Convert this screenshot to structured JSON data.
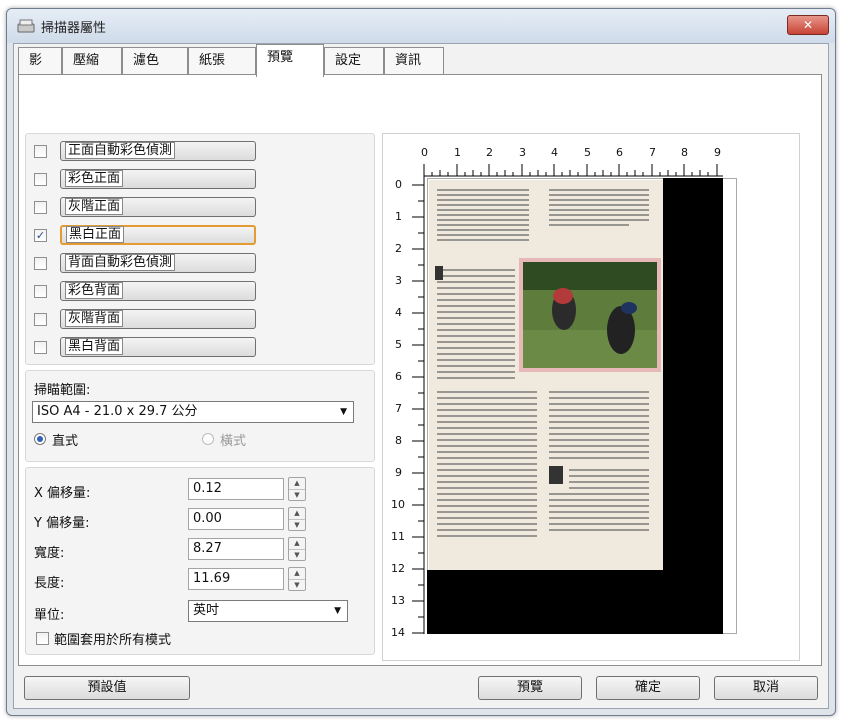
{
  "window": {
    "title": "掃描器屬性",
    "close_label": "✕"
  },
  "tabs": [
    "影像",
    "壓縮",
    "濾色",
    "紙張",
    "預覽",
    "設定",
    "資訊"
  ],
  "active_tab": 4,
  "preview_options": [
    {
      "label": "正面自動彩色偵測",
      "checked": false
    },
    {
      "label": "彩色正面",
      "checked": false
    },
    {
      "label": "灰階正面",
      "checked": false
    },
    {
      "label": "黑白正面",
      "checked": true
    },
    {
      "label": "背面自動彩色偵測",
      "checked": false
    },
    {
      "label": "彩色背面",
      "checked": false
    },
    {
      "label": "灰階背面",
      "checked": false
    },
    {
      "label": "黑白背面",
      "checked": false
    }
  ],
  "scan_area": {
    "label": "掃瞄範圍:",
    "value": "ISO A4 - 21.0 x 29.7 公分",
    "portrait_label": "直式",
    "landscape_label": "橫式",
    "orientation": "portrait"
  },
  "fields": [
    {
      "label": "X 偏移量:",
      "value": "0.12"
    },
    {
      "label": "Y 偏移量:",
      "value": "0.00"
    },
    {
      "label": "寬度:",
      "value": "8.27"
    },
    {
      "label": "長度:",
      "value": "11.69"
    }
  ],
  "unit": {
    "label": "單位:",
    "value": "英吋"
  },
  "apply_all": {
    "label": "範圍套用於所有模式",
    "checked": false
  },
  "ruler": {
    "top": [
      "0",
      "1",
      "2",
      "3",
      "4",
      "5",
      "6",
      "7",
      "8",
      "9"
    ],
    "left": [
      "0",
      "1",
      "2",
      "3",
      "4",
      "5",
      "6",
      "7",
      "8",
      "9",
      "10",
      "11",
      "12",
      "13",
      "14"
    ]
  },
  "buttons": {
    "defaults": "預設值",
    "preview": "預覽",
    "ok": "確定",
    "cancel": "取消"
  }
}
